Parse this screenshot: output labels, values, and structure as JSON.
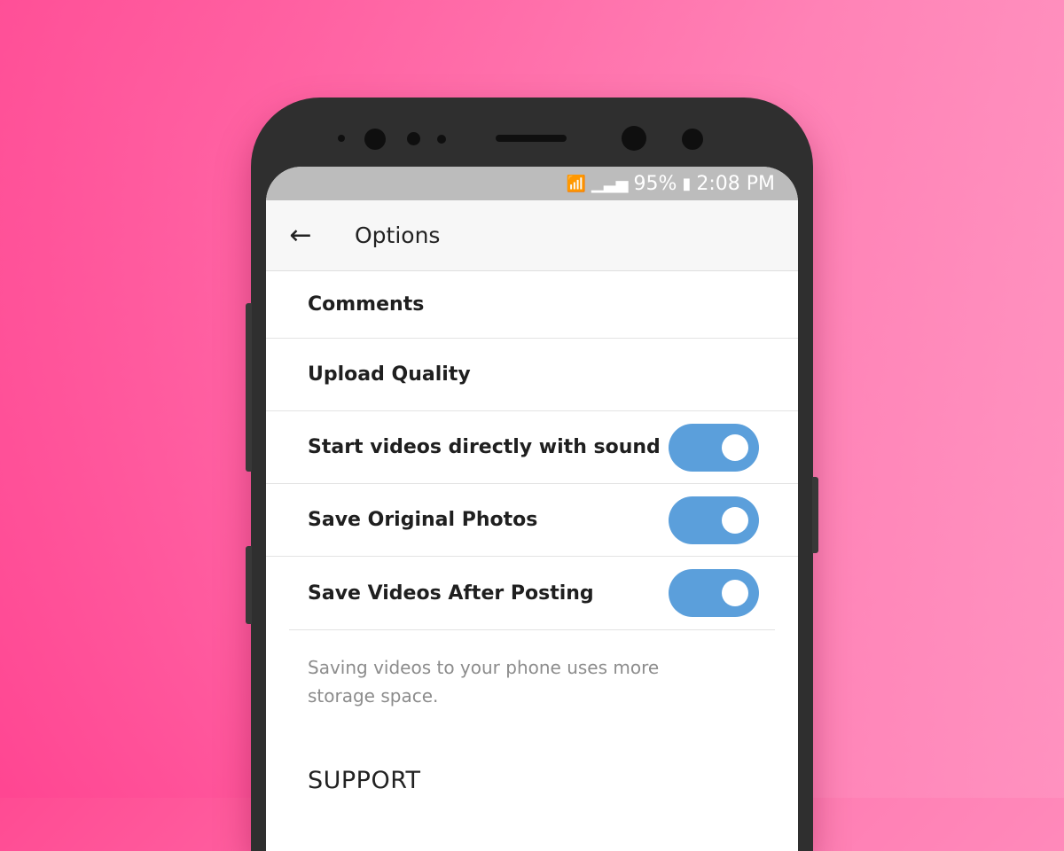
{
  "status_bar": {
    "battery": "95%",
    "time": "2:08 PM",
    "wifi_icon": "wifi-icon",
    "signal_icon": "signal-icon",
    "battery_icon": "battery-icon"
  },
  "header": {
    "title": "Options",
    "back_icon": "arrow-left-icon"
  },
  "settings": {
    "comments": {
      "label": "Comments"
    },
    "upload_quality": {
      "label": "Upload Quality"
    },
    "start_videos_sound": {
      "label": "Start videos directly with sound",
      "enabled": true
    },
    "save_original_photos": {
      "label": "Save Original Photos",
      "enabled": true
    },
    "save_videos_after_posting": {
      "label": "Save Videos After Posting",
      "enabled": true
    }
  },
  "note": "Saving videos to your phone uses more storage space.",
  "support_section": "SUPPORT",
  "colors": {
    "toggle_on": "#5b9fdb",
    "background_pink": "#ff5fa0"
  }
}
